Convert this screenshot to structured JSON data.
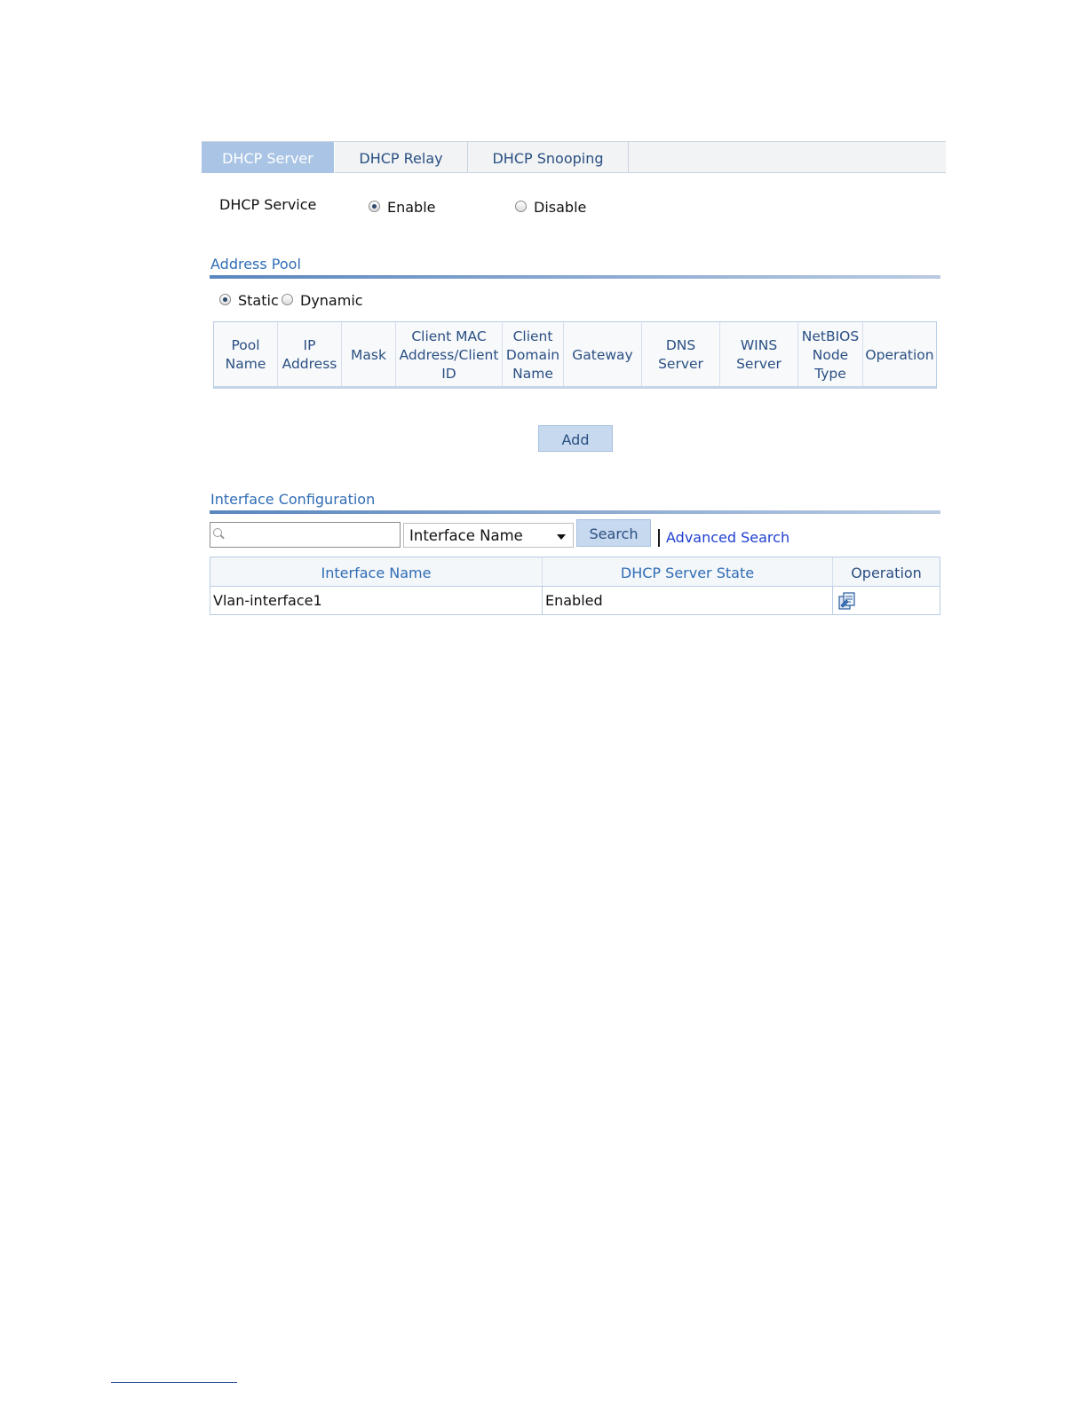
{
  "tabs": [
    {
      "label": "DHCP Server",
      "active": true
    },
    {
      "label": "DHCP Relay",
      "active": false
    },
    {
      "label": "DHCP Snooping",
      "active": false
    }
  ],
  "dhcp_service": {
    "label": "DHCP Service",
    "options": [
      {
        "label": "Enable",
        "selected": true
      },
      {
        "label": "Disable",
        "selected": false
      }
    ]
  },
  "address_pool": {
    "title": "Address Pool",
    "mode_options": [
      {
        "label": "Static",
        "selected": true
      },
      {
        "label": "Dynamic",
        "selected": false
      }
    ],
    "columns": [
      "Pool\nName",
      "IP\nAddress",
      "Mask",
      "Client MAC\nAddress/Client\nID",
      "Client\nDomain\nName",
      "Gateway",
      "DNS\nServer",
      "WINS\nServer",
      "NetBIOS\nNode\nType",
      "Operation"
    ],
    "add_label": "Add"
  },
  "interface_config": {
    "title": "Interface Configuration",
    "search_value": "",
    "search_field": "Interface Name",
    "search_label": "Search",
    "advanced_search_label": "Advanced Search",
    "columns": [
      "Interface Name",
      "DHCP Server State",
      "Operation"
    ],
    "rows": [
      {
        "interface": "Vlan-interface1",
        "state": "Enabled",
        "operation_icon": "configure-icon"
      }
    ]
  },
  "colors": {
    "accent": "#2f6cb4",
    "tab_active_bg": "#a9c4e4",
    "button_bg": "#c7d9ef",
    "link": "#1f3fd0"
  }
}
